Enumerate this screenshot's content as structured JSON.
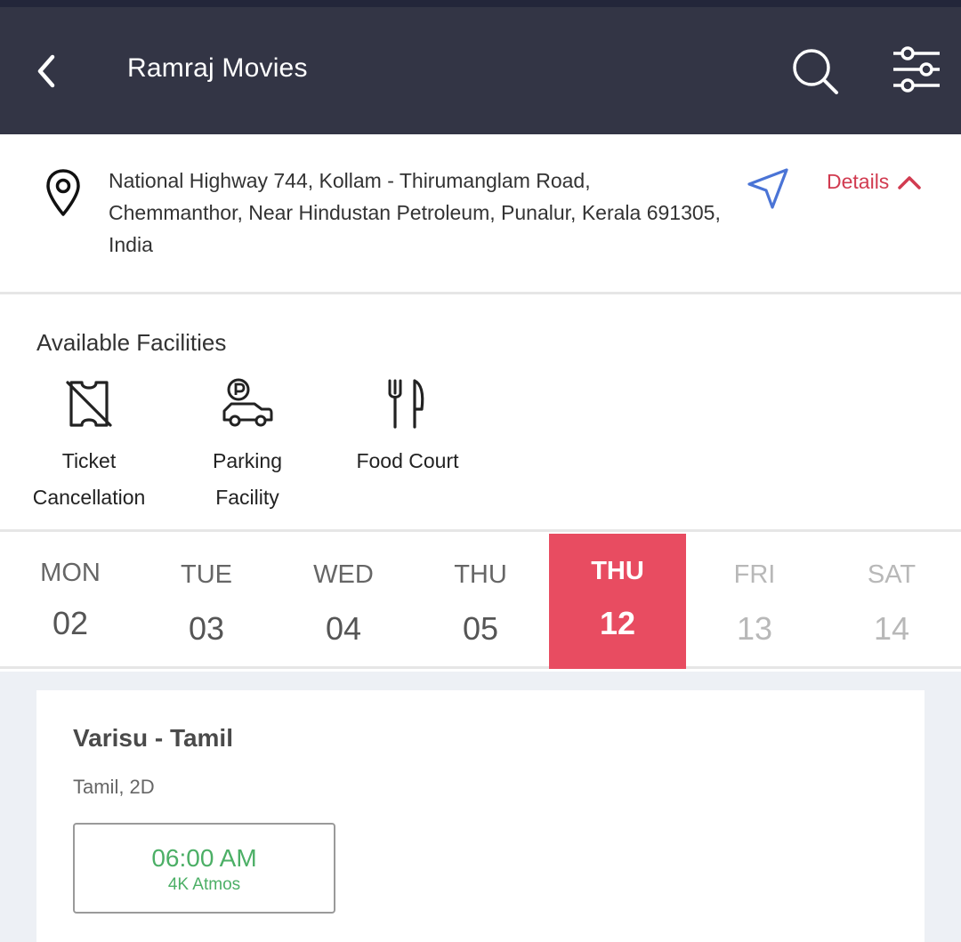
{
  "header": {
    "title": "Ramraj Movies",
    "back_icon": "chevron-left-icon",
    "search_icon": "search-icon",
    "filter_icon": "sliders-icon"
  },
  "address": {
    "line1": "National Highway 744, Kollam - Thirumanglam Road,",
    "line2": "Chemmanthor, Near Hindustan Petroleum, Punalur, Kerala 691305,",
    "line3": "India",
    "details_label": "Details"
  },
  "facilities": {
    "title": "Available Facilities",
    "items": [
      {
        "label_line1": "Ticket",
        "label_line2": "Cancellation",
        "icon": "ticket-cancel-icon"
      },
      {
        "label_line1": "Parking",
        "label_line2": "Facility",
        "icon": "parking-car-icon"
      },
      {
        "label_line1": "Food Court",
        "label_line2": "",
        "icon": "cutlery-icon"
      }
    ]
  },
  "dates": [
    {
      "day": "MON",
      "num": "02",
      "state": "normal"
    },
    {
      "day": "TUE",
      "num": "03",
      "state": "normal"
    },
    {
      "day": "WED",
      "num": "04",
      "state": "normal"
    },
    {
      "day": "THU",
      "num": "05",
      "state": "normal"
    },
    {
      "day": "THU",
      "num": "12",
      "state": "selected"
    },
    {
      "day": "FRI",
      "num": "13",
      "state": "disabled"
    },
    {
      "day": "SAT",
      "num": "14",
      "state": "disabled"
    }
  ],
  "movie": {
    "title": "Varisu - Tamil",
    "meta": "Tamil, 2D",
    "showtimes": [
      {
        "time": "06:00 AM",
        "format": "4K Atmos"
      }
    ]
  },
  "colors": {
    "header_bg": "#333545",
    "accent": "#e84c61",
    "details_red": "#d13b50",
    "nav_blue": "#4a74d6",
    "showtime_green": "#4caf66"
  }
}
